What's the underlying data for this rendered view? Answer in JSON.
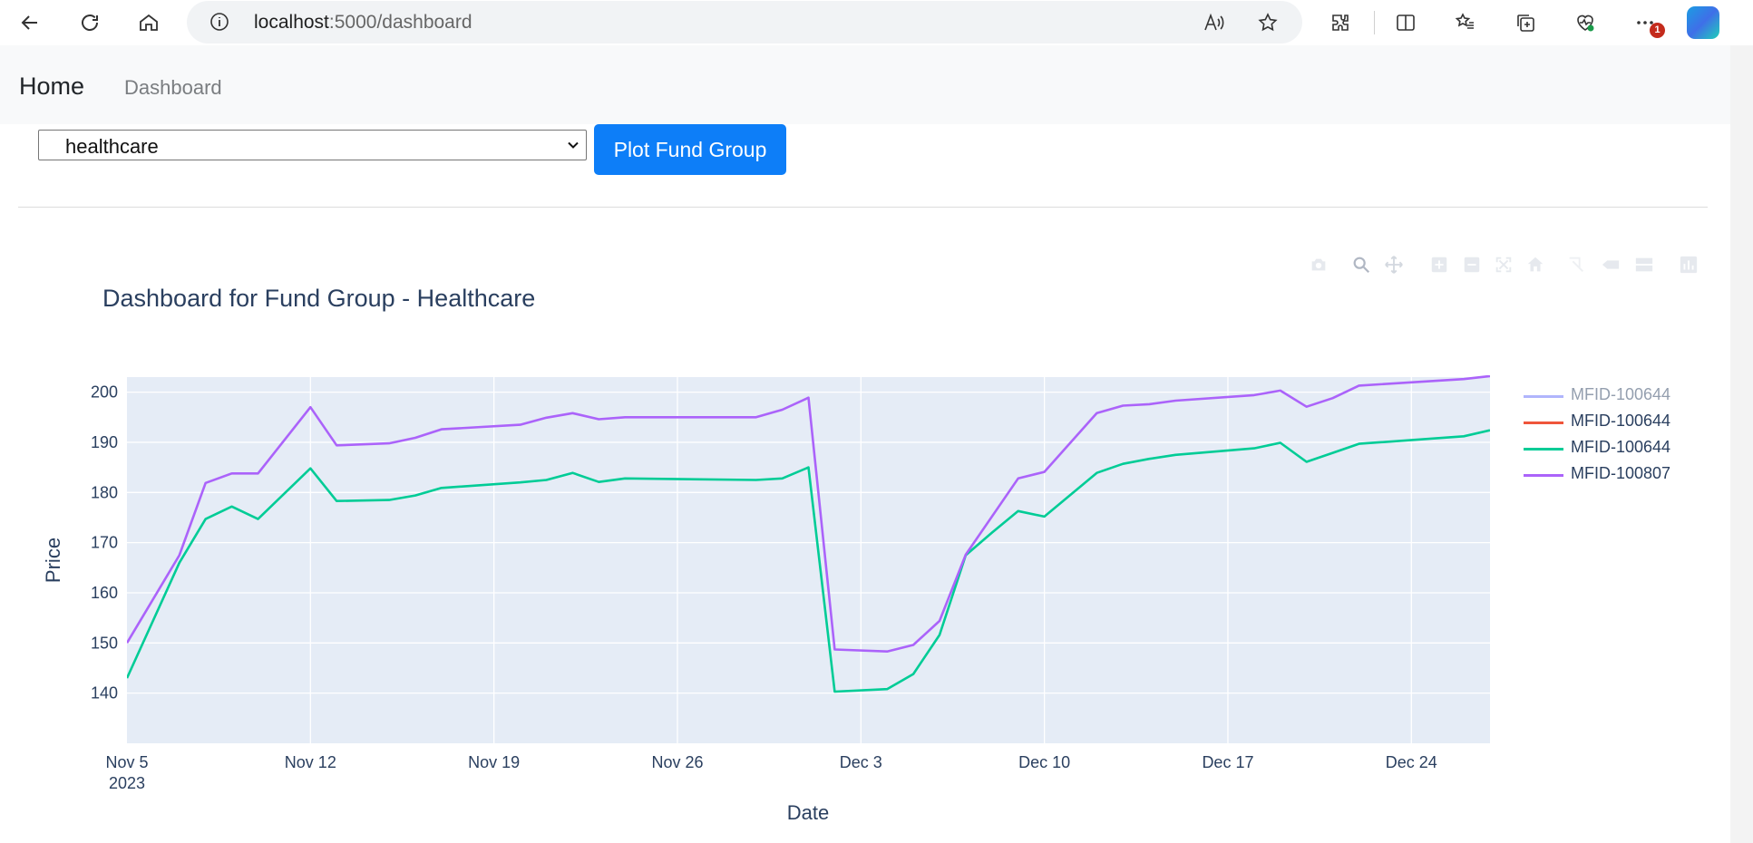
{
  "browser": {
    "url_host": "localhost",
    "url_rest": ":5000/dashboard",
    "notification_count": "1"
  },
  "navbar": {
    "brand": "Home",
    "link": "Dashboard"
  },
  "controls": {
    "fund_group_selected": "healthcare",
    "plot_button_label": "Plot Fund Group"
  },
  "chart_data": {
    "type": "line",
    "title": "Dashboard for Fund Group - Healthcare",
    "xlabel": "Date",
    "ylabel": "Price",
    "x_start": "2023-11-05",
    "xlim": [
      "2023-11-05",
      "2023-12-27"
    ],
    "ylim": [
      130,
      203
    ],
    "yticks": [
      "200",
      "190",
      "180",
      "170",
      "160",
      "150",
      "140"
    ],
    "xticks": [
      {
        "date": "2023-11-05",
        "label": "Nov 5",
        "sub": "2023"
      },
      {
        "date": "2023-11-12",
        "label": "Nov 12",
        "sub": ""
      },
      {
        "date": "2023-11-19",
        "label": "Nov 19",
        "sub": ""
      },
      {
        "date": "2023-11-26",
        "label": "Nov 26",
        "sub": ""
      },
      {
        "date": "2023-12-03",
        "label": "Dec 3",
        "sub": ""
      },
      {
        "date": "2023-12-10",
        "label": "Dec 10",
        "sub": ""
      },
      {
        "date": "2023-12-17",
        "label": "Dec 17",
        "sub": ""
      },
      {
        "date": "2023-12-24",
        "label": "Dec 24",
        "sub": ""
      }
    ],
    "grid": true,
    "legend_position": "right",
    "series": [
      {
        "name": "MFID-100644",
        "color": "#636efa",
        "legend_faded": true,
        "points": []
      },
      {
        "name": "MFID-100644",
        "color": "#ef553b",
        "legend_faded": false,
        "points": []
      },
      {
        "name": "MFID-100644",
        "color": "#00cc96",
        "legend_faded": false,
        "points": [
          [
            "2023-11-05",
            143
          ],
          [
            "2023-11-07",
            166
          ],
          [
            "2023-11-08",
            174.7
          ],
          [
            "2023-11-09",
            177.2
          ],
          [
            "2023-11-10",
            174.7
          ],
          [
            "2023-11-12",
            184.8
          ],
          [
            "2023-11-13",
            178.3
          ],
          [
            "2023-11-15",
            178.5
          ],
          [
            "2023-11-16",
            179.4
          ],
          [
            "2023-11-17",
            180.9
          ],
          [
            "2023-11-20",
            182
          ],
          [
            "2023-11-21",
            182.5
          ],
          [
            "2023-11-22",
            183.9
          ],
          [
            "2023-11-23",
            182.1
          ],
          [
            "2023-11-24",
            182.8
          ],
          [
            "2023-11-29",
            182.5
          ],
          [
            "2023-11-30",
            182.8
          ],
          [
            "2023-12-01",
            185
          ],
          [
            "2023-12-02",
            140.3
          ],
          [
            "2023-12-04",
            140.8
          ],
          [
            "2023-12-05",
            143.8
          ],
          [
            "2023-12-06",
            151.6
          ],
          [
            "2023-12-07",
            167.5
          ],
          [
            "2023-12-08",
            172
          ],
          [
            "2023-12-09",
            176.3
          ],
          [
            "2023-12-10",
            175.2
          ],
          [
            "2023-12-12",
            183.9
          ],
          [
            "2023-12-13",
            185.7
          ],
          [
            "2023-12-14",
            186.7
          ],
          [
            "2023-12-15",
            187.5
          ],
          [
            "2023-12-18",
            188.8
          ],
          [
            "2023-12-19",
            189.9
          ],
          [
            "2023-12-20",
            186.1
          ],
          [
            "2023-12-21",
            187.9
          ],
          [
            "2023-12-22",
            189.7
          ],
          [
            "2023-12-26",
            191.2
          ],
          [
            "2023-12-27",
            192.4
          ]
        ]
      },
      {
        "name": "MFID-100807",
        "color": "#ab63fa",
        "legend_faded": false,
        "points": [
          [
            "2023-11-05",
            150
          ],
          [
            "2023-11-07",
            167.5
          ],
          [
            "2023-11-08",
            181.9
          ],
          [
            "2023-11-09",
            183.8
          ],
          [
            "2023-11-10",
            183.8
          ],
          [
            "2023-11-12",
            197
          ],
          [
            "2023-11-13",
            189.4
          ],
          [
            "2023-11-15",
            189.8
          ],
          [
            "2023-11-16",
            190.9
          ],
          [
            "2023-11-17",
            192.6
          ],
          [
            "2023-11-20",
            193.5
          ],
          [
            "2023-11-21",
            194.9
          ],
          [
            "2023-11-22",
            195.8
          ],
          [
            "2023-11-23",
            194.6
          ],
          [
            "2023-11-24",
            195
          ],
          [
            "2023-11-29",
            195
          ],
          [
            "2023-11-30",
            196.5
          ],
          [
            "2023-12-01",
            198.9
          ],
          [
            "2023-12-02",
            148.7
          ],
          [
            "2023-12-04",
            148.3
          ],
          [
            "2023-12-05",
            149.6
          ],
          [
            "2023-12-06",
            154.4
          ],
          [
            "2023-12-07",
            167.6
          ],
          [
            "2023-12-09",
            182.8
          ],
          [
            "2023-12-10",
            184.1
          ],
          [
            "2023-12-12",
            195.8
          ],
          [
            "2023-12-13",
            197.3
          ],
          [
            "2023-12-14",
            197.6
          ],
          [
            "2023-12-15",
            198.3
          ],
          [
            "2023-12-18",
            199.4
          ],
          [
            "2023-12-19",
            200.3
          ],
          [
            "2023-12-20",
            197.1
          ],
          [
            "2023-12-21",
            198.8
          ],
          [
            "2023-12-22",
            201.3
          ],
          [
            "2023-12-26",
            202.6
          ],
          [
            "2023-12-27",
            203.2
          ]
        ]
      }
    ]
  }
}
